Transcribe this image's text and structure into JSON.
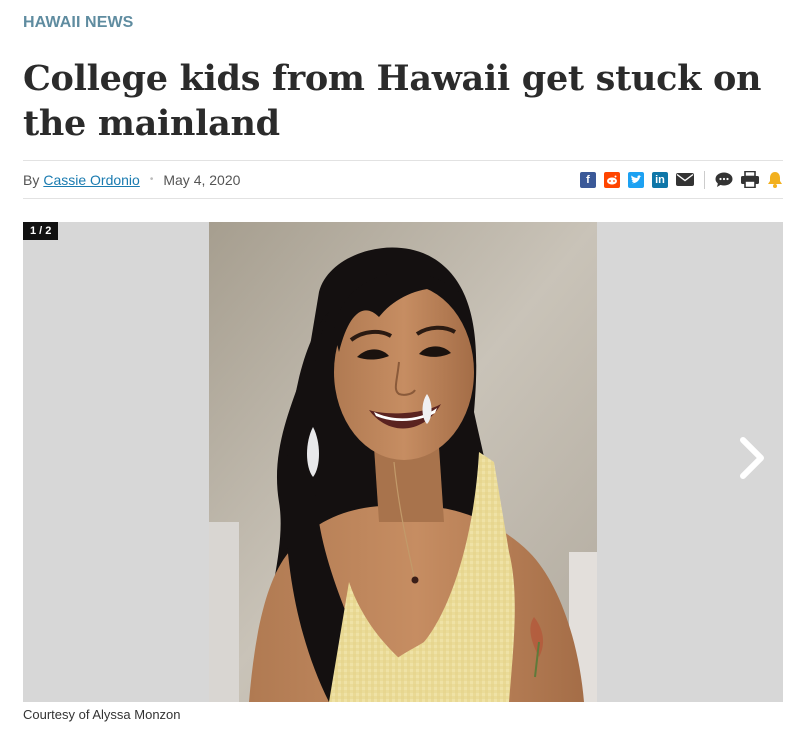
{
  "section": {
    "label": "HAWAII NEWS"
  },
  "article": {
    "headline": "College kids from Hawaii get stuck on the mainland",
    "byline_prefix": "By",
    "author": "Cassie Ordonio",
    "separator": "•",
    "date": "May 4, 2020"
  },
  "share_icons": [
    {
      "name": "facebook-icon",
      "color": "#3b5998",
      "glyph": "f"
    },
    {
      "name": "reddit-icon",
      "color": "#ff4500",
      "glyph": "●"
    },
    {
      "name": "twitter-icon",
      "color": "#1da1f2",
      "glyph": "✓"
    },
    {
      "name": "linkedin-icon",
      "color": "#0e76a8",
      "glyph": "in"
    },
    {
      "name": "email-icon",
      "color": "#333333"
    },
    {
      "name": "comment-icon",
      "color": "#333333"
    },
    {
      "name": "print-icon",
      "color": "#333333"
    },
    {
      "name": "bell-icon",
      "color": "#f2b01e"
    }
  ],
  "gallery": {
    "counter": "1 / 2",
    "next_icon": "chevron-right-icon",
    "caption": "Courtesy of Alyssa Monzon"
  }
}
